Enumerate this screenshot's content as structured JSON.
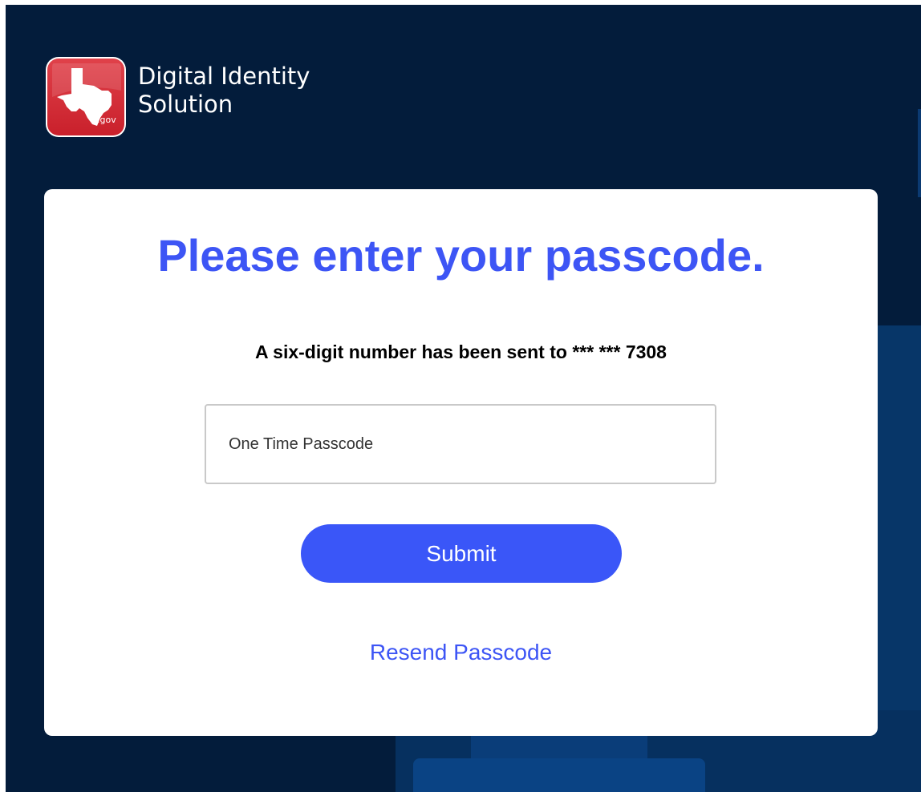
{
  "brand": {
    "line1": "Digital Identity",
    "line2": "Solution",
    "logo_icon": "texas-gov-icon",
    "logo_badge": ".gov"
  },
  "card": {
    "title": "Please enter your passcode.",
    "subtitle": "A six-digit number has been sent to *** *** 7308",
    "input_placeholder": "One Time Passcode",
    "input_value": "",
    "submit_label": "Submit",
    "resend_label": "Resend Passcode"
  },
  "colors": {
    "background": "#031c3b",
    "accent": "#3d55f5",
    "logo_red": "#d6303a"
  }
}
